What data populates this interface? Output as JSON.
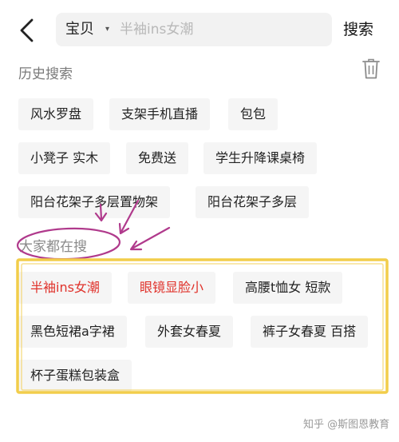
{
  "header": {
    "back_icon": "chevron-left-icon",
    "scope_label": "宝贝",
    "scope_caret": "▾",
    "search_placeholder": "半袖ins女潮",
    "search_button": "搜索"
  },
  "history": {
    "title": "历史搜索",
    "delete_icon": "trash-icon",
    "items": [
      "风水罗盘",
      "支架手机直播",
      "包包",
      "小凳子 实木",
      "免费送",
      "学生升降课桌椅",
      "阳台花架子多层置物架",
      "阳台花架子多层"
    ]
  },
  "trending": {
    "title": "大家都在搜",
    "items": [
      {
        "label": "半袖ins女潮",
        "hot": true
      },
      {
        "label": "眼镜显脸小",
        "hot": true
      },
      {
        "label": "高腰t恤女 短款",
        "hot": false
      },
      {
        "label": "黑色短裙a字裙",
        "hot": false
      },
      {
        "label": "外套女春夏",
        "hot": false
      },
      {
        "label": "裤子女春夏 百搭",
        "hot": false
      },
      {
        "label": "杯子蛋糕包装盒",
        "hot": false
      }
    ]
  },
  "annotations": {
    "circle_color": "#b03a8c",
    "arrow_color": "#b03a8c",
    "highlight_box_color": "#f2cd4a"
  },
  "watermark": "知乎 @斯图恩教育"
}
